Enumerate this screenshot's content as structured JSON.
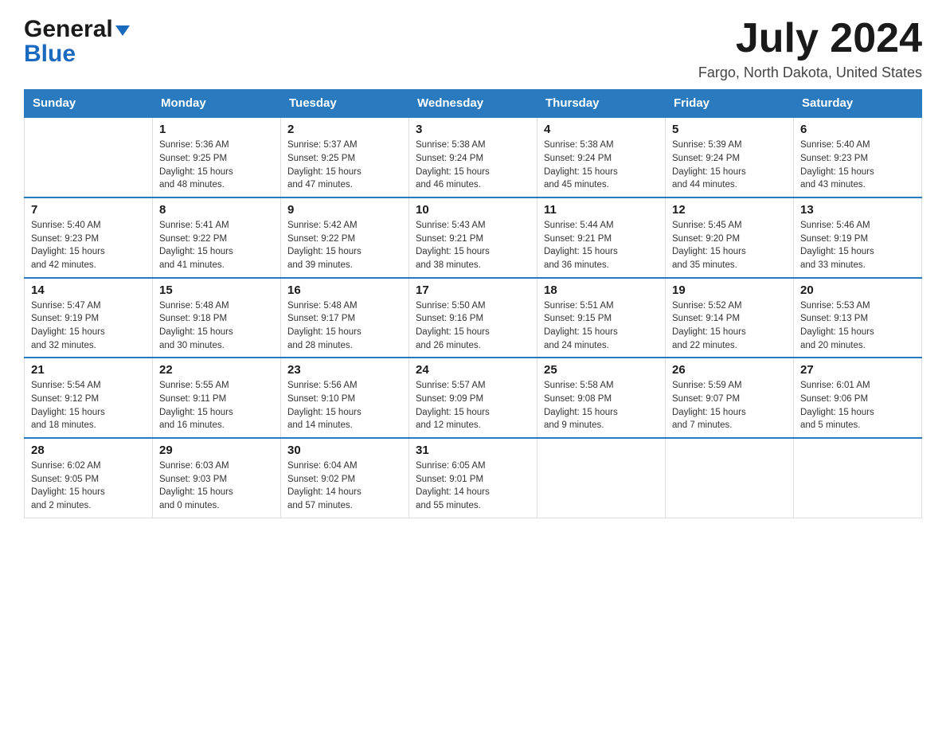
{
  "header": {
    "logo_general": "General",
    "logo_blue": "Blue",
    "month_title": "July 2024",
    "location": "Fargo, North Dakota, United States"
  },
  "weekdays": [
    "Sunday",
    "Monday",
    "Tuesday",
    "Wednesday",
    "Thursday",
    "Friday",
    "Saturday"
  ],
  "weeks": [
    [
      {
        "day": "",
        "info": ""
      },
      {
        "day": "1",
        "info": "Sunrise: 5:36 AM\nSunset: 9:25 PM\nDaylight: 15 hours\nand 48 minutes."
      },
      {
        "day": "2",
        "info": "Sunrise: 5:37 AM\nSunset: 9:25 PM\nDaylight: 15 hours\nand 47 minutes."
      },
      {
        "day": "3",
        "info": "Sunrise: 5:38 AM\nSunset: 9:24 PM\nDaylight: 15 hours\nand 46 minutes."
      },
      {
        "day": "4",
        "info": "Sunrise: 5:38 AM\nSunset: 9:24 PM\nDaylight: 15 hours\nand 45 minutes."
      },
      {
        "day": "5",
        "info": "Sunrise: 5:39 AM\nSunset: 9:24 PM\nDaylight: 15 hours\nand 44 minutes."
      },
      {
        "day": "6",
        "info": "Sunrise: 5:40 AM\nSunset: 9:23 PM\nDaylight: 15 hours\nand 43 minutes."
      }
    ],
    [
      {
        "day": "7",
        "info": "Sunrise: 5:40 AM\nSunset: 9:23 PM\nDaylight: 15 hours\nand 42 minutes."
      },
      {
        "day": "8",
        "info": "Sunrise: 5:41 AM\nSunset: 9:22 PM\nDaylight: 15 hours\nand 41 minutes."
      },
      {
        "day": "9",
        "info": "Sunrise: 5:42 AM\nSunset: 9:22 PM\nDaylight: 15 hours\nand 39 minutes."
      },
      {
        "day": "10",
        "info": "Sunrise: 5:43 AM\nSunset: 9:21 PM\nDaylight: 15 hours\nand 38 minutes."
      },
      {
        "day": "11",
        "info": "Sunrise: 5:44 AM\nSunset: 9:21 PM\nDaylight: 15 hours\nand 36 minutes."
      },
      {
        "day": "12",
        "info": "Sunrise: 5:45 AM\nSunset: 9:20 PM\nDaylight: 15 hours\nand 35 minutes."
      },
      {
        "day": "13",
        "info": "Sunrise: 5:46 AM\nSunset: 9:19 PM\nDaylight: 15 hours\nand 33 minutes."
      }
    ],
    [
      {
        "day": "14",
        "info": "Sunrise: 5:47 AM\nSunset: 9:19 PM\nDaylight: 15 hours\nand 32 minutes."
      },
      {
        "day": "15",
        "info": "Sunrise: 5:48 AM\nSunset: 9:18 PM\nDaylight: 15 hours\nand 30 minutes."
      },
      {
        "day": "16",
        "info": "Sunrise: 5:48 AM\nSunset: 9:17 PM\nDaylight: 15 hours\nand 28 minutes."
      },
      {
        "day": "17",
        "info": "Sunrise: 5:50 AM\nSunset: 9:16 PM\nDaylight: 15 hours\nand 26 minutes."
      },
      {
        "day": "18",
        "info": "Sunrise: 5:51 AM\nSunset: 9:15 PM\nDaylight: 15 hours\nand 24 minutes."
      },
      {
        "day": "19",
        "info": "Sunrise: 5:52 AM\nSunset: 9:14 PM\nDaylight: 15 hours\nand 22 minutes."
      },
      {
        "day": "20",
        "info": "Sunrise: 5:53 AM\nSunset: 9:13 PM\nDaylight: 15 hours\nand 20 minutes."
      }
    ],
    [
      {
        "day": "21",
        "info": "Sunrise: 5:54 AM\nSunset: 9:12 PM\nDaylight: 15 hours\nand 18 minutes."
      },
      {
        "day": "22",
        "info": "Sunrise: 5:55 AM\nSunset: 9:11 PM\nDaylight: 15 hours\nand 16 minutes."
      },
      {
        "day": "23",
        "info": "Sunrise: 5:56 AM\nSunset: 9:10 PM\nDaylight: 15 hours\nand 14 minutes."
      },
      {
        "day": "24",
        "info": "Sunrise: 5:57 AM\nSunset: 9:09 PM\nDaylight: 15 hours\nand 12 minutes."
      },
      {
        "day": "25",
        "info": "Sunrise: 5:58 AM\nSunset: 9:08 PM\nDaylight: 15 hours\nand 9 minutes."
      },
      {
        "day": "26",
        "info": "Sunrise: 5:59 AM\nSunset: 9:07 PM\nDaylight: 15 hours\nand 7 minutes."
      },
      {
        "day": "27",
        "info": "Sunrise: 6:01 AM\nSunset: 9:06 PM\nDaylight: 15 hours\nand 5 minutes."
      }
    ],
    [
      {
        "day": "28",
        "info": "Sunrise: 6:02 AM\nSunset: 9:05 PM\nDaylight: 15 hours\nand 2 minutes."
      },
      {
        "day": "29",
        "info": "Sunrise: 6:03 AM\nSunset: 9:03 PM\nDaylight: 15 hours\nand 0 minutes."
      },
      {
        "day": "30",
        "info": "Sunrise: 6:04 AM\nSunset: 9:02 PM\nDaylight: 14 hours\nand 57 minutes."
      },
      {
        "day": "31",
        "info": "Sunrise: 6:05 AM\nSunset: 9:01 PM\nDaylight: 14 hours\nand 55 minutes."
      },
      {
        "day": "",
        "info": ""
      },
      {
        "day": "",
        "info": ""
      },
      {
        "day": "",
        "info": ""
      }
    ]
  ]
}
